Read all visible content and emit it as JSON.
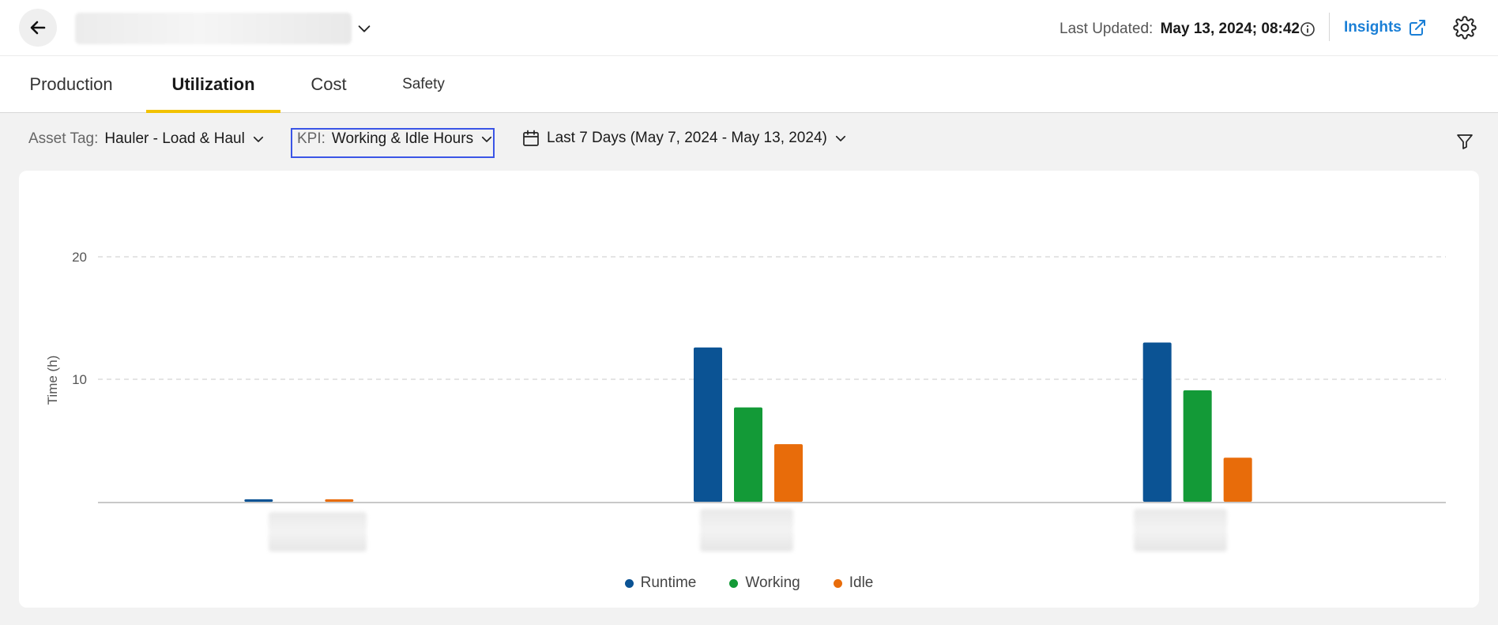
{
  "header": {
    "last_updated_label": "Last Updated:",
    "last_updated_value": "May 13, 2024; 08:42",
    "insights_label": "Insights"
  },
  "tabs": [
    {
      "label": "Production",
      "active": false
    },
    {
      "label": "Utilization",
      "active": true
    },
    {
      "label": "Cost",
      "active": false
    },
    {
      "label": "Safety",
      "active": false
    }
  ],
  "filters": {
    "asset_tag_label": "Asset Tag:",
    "asset_tag_value": "Hauler - Load & Haul",
    "kpi_label": "KPI:",
    "kpi_value": "Working & Idle Hours",
    "date_range": "Last 7 Days (May 7, 2024 - May 13, 2024)"
  },
  "colors": {
    "runtime": "#0b5394",
    "working": "#139a37",
    "idle": "#e86c0a",
    "accent": "#f2c200",
    "link": "#1a7fd6"
  },
  "chart_data": {
    "type": "bar",
    "ylabel": "Time (h)",
    "ylim": [
      0,
      20
    ],
    "yticks": [
      10,
      20
    ],
    "grid": true,
    "legend_position": "bottom",
    "categories": [
      "",
      "",
      ""
    ],
    "series": [
      {
        "name": "Runtime",
        "color": "#0b5394",
        "values": [
          0.2,
          12.6,
          13.0
        ]
      },
      {
        "name": "Working",
        "color": "#139a37",
        "values": [
          0.0,
          7.7,
          9.1
        ]
      },
      {
        "name": "Idle",
        "color": "#e86c0a",
        "values": [
          0.2,
          4.7,
          3.6
        ]
      }
    ]
  }
}
